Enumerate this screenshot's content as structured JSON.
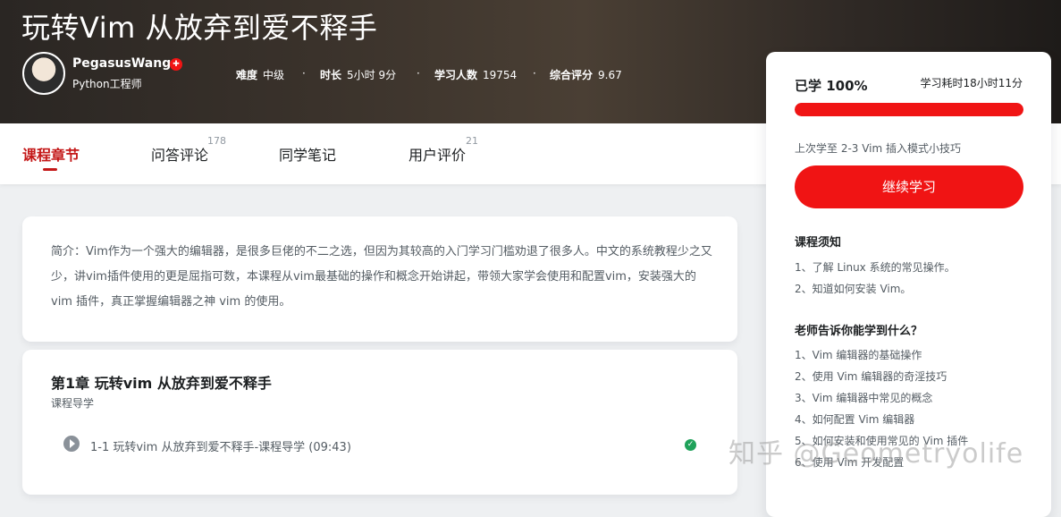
{
  "course": {
    "title": "玩转Vim 从放弃到爱不释手",
    "teacher_name": "PegasusWang",
    "teacher_badge": "✚",
    "teacher_role": "Python工程师",
    "meta": [
      {
        "label": "难度",
        "value": "中级"
      },
      {
        "label": "时长",
        "value": "5小时 9分"
      },
      {
        "label": "学习人数",
        "value": "19754"
      },
      {
        "label": "综合评分",
        "value": "9.67"
      }
    ],
    "separator": "·"
  },
  "tabs": [
    {
      "label": "课程章节",
      "count": ""
    },
    {
      "label": "问答评论",
      "count": "178"
    },
    {
      "label": "同学笔记",
      "count": ""
    },
    {
      "label": "用户评价",
      "count": "21"
    }
  ],
  "intro": "简介：Vim作为一个强大的编辑器，是很多巨佬的不二之选，但因为其较高的入门学习门槛劝退了很多人。中文的系统教程少之又少，讲vim插件使用的更是屈指可数，本课程从vim最基础的操作和概念开始讲起，带领大家学会使用和配置vim，安装强大的 vim 插件，真正掌握编辑器之神 vim 的使用。",
  "chapter": {
    "title": "第1章 玩转vim 从放弃到爱不释手",
    "subtitle": "课程导学",
    "lesson": "1-1 玩转vim 从放弃到爱不释手-课程导学 (09:43)",
    "check": "✓"
  },
  "sidebar": {
    "progress_label": "已学 100%",
    "progress_fraction": 1.0,
    "time_spent": "学习耗时18小时11分",
    "last_learned": "上次学至 2-3 Vim 插入模式小技巧",
    "continue_button": "继续学习",
    "notice_title": "课程须知",
    "notice_items": [
      "1、了解 Linux 系统的常见操作。",
      "2、知道如何安装 Vim。"
    ],
    "learn_title": "老师告诉你能学到什么？",
    "learn_items": [
      "1、Vim 编辑器的基础操作",
      "2、使用 Vim 编辑器的奇淫技巧",
      "3、Vim 编辑器中常见的概念",
      "4、如何配置 Vim 编辑器",
      "5、如何安装和使用常见的 Vim 插件",
      "6、使用 Vim 开发配置"
    ]
  },
  "watermark": "知乎 @Geometryolife",
  "colors": {
    "accent": "#f01414",
    "active_tab": "#c41818",
    "check": "#1fa25a"
  }
}
